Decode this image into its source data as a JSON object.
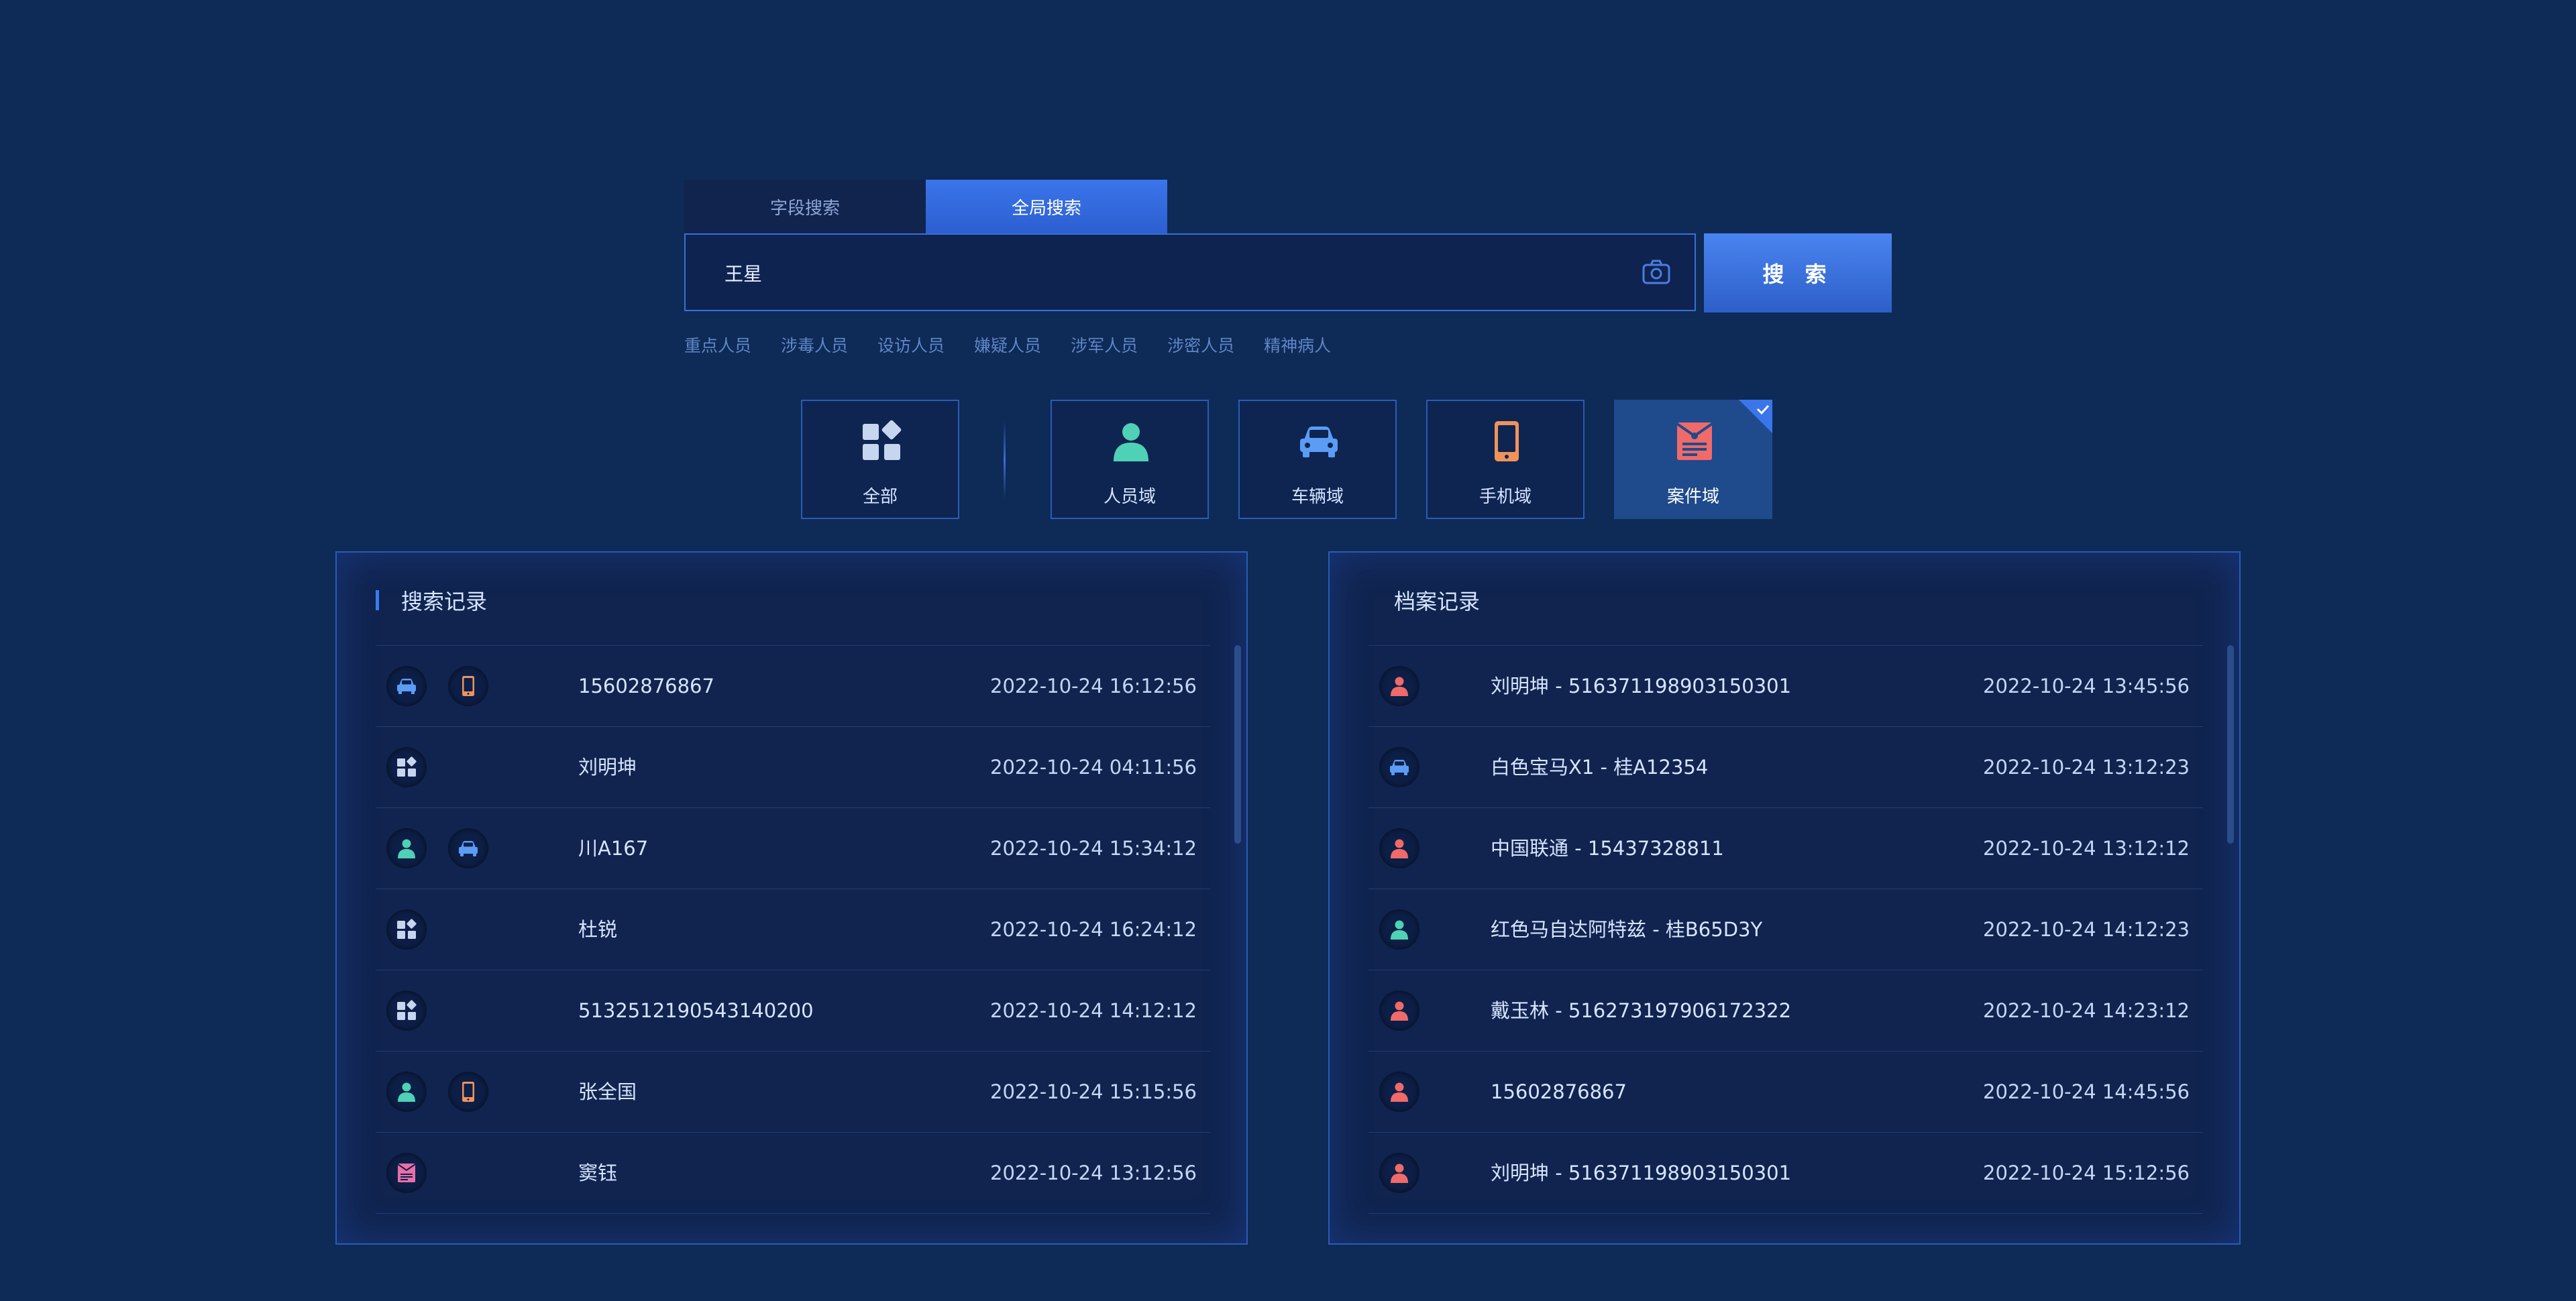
{
  "tabs": [
    {
      "label": "字段搜索",
      "active": false
    },
    {
      "label": "全局搜索",
      "active": true
    }
  ],
  "search": {
    "value": "王星",
    "button_label": "搜 索"
  },
  "quick_tags": [
    "重点人员",
    "涉毒人员",
    "设访人员",
    "嫌疑人员",
    "涉军人员",
    "涉密人员",
    "精神病人"
  ],
  "domains": [
    {
      "label": "全部",
      "icon": "grid-icon",
      "active": false
    },
    {
      "label": "人员域",
      "icon": "person-icon",
      "active": false
    },
    {
      "label": "车辆域",
      "icon": "car-icon",
      "active": false
    },
    {
      "label": "手机域",
      "icon": "phone-icon",
      "active": false
    },
    {
      "label": "案件域",
      "icon": "case-icon",
      "active": true
    }
  ],
  "colors": {
    "background": "#0e2a56",
    "accent": "#3a75ea",
    "person_teal": "#4fd1b5",
    "car_blue": "#5b9cf5",
    "phone_orange": "#f0935a",
    "case_red": "#f06a6a"
  },
  "search_history": {
    "title": "搜索记录",
    "rows": [
      {
        "icons": [
          "car-icon",
          "phone-icon"
        ],
        "text": "15602876867",
        "time": "2022-10-24 16:12:56"
      },
      {
        "icons": [
          "grid-icon"
        ],
        "text": "刘明坤",
        "time": "2022-10-24 04:11:56"
      },
      {
        "icons": [
          "person-icon",
          "car-icon"
        ],
        "text": "川A167",
        "time": "2022-10-24 15:34:12"
      },
      {
        "icons": [
          "grid-icon"
        ],
        "text": "杜锐",
        "time": "2022-10-24 16:24:12"
      },
      {
        "icons": [
          "grid-icon"
        ],
        "text": "5132512190543140200",
        "time": "2022-10-24 14:12:12"
      },
      {
        "icons": [
          "person-icon",
          "phone-icon"
        ],
        "text": "张全国",
        "time": "2022-10-24 15:15:56"
      },
      {
        "icons": [
          "case-icon"
        ],
        "text": "窦钰",
        "time": "2022-10-24 13:12:56"
      }
    ]
  },
  "archive_records": {
    "title": "档案记录",
    "rows": [
      {
        "icon": "person-red-icon",
        "text": "刘明坤 - 516371198903150301",
        "time": "2022-10-24 13:45:56"
      },
      {
        "icon": "car-icon",
        "text": "白色宝马X1 - 桂A12354",
        "time": "2022-10-24 13:12:23"
      },
      {
        "icon": "person-red-icon",
        "text": "中国联通 - 15437328811",
        "time": "2022-10-24 13:12:12"
      },
      {
        "icon": "person-icon",
        "text": "红色马自达阿特兹 - 桂B65D3Y",
        "time": "2022-10-24 14:12:23"
      },
      {
        "icon": "person-red-icon",
        "text": "戴玉林 - 516273197906172322",
        "time": "2022-10-24 14:23:12"
      },
      {
        "icon": "person-red-icon",
        "text": "15602876867",
        "time": "2022-10-24 14:45:56"
      },
      {
        "icon": "person-red-icon",
        "text": "刘明坤 - 516371198903150301",
        "time": "2022-10-24 15:12:56"
      }
    ]
  }
}
